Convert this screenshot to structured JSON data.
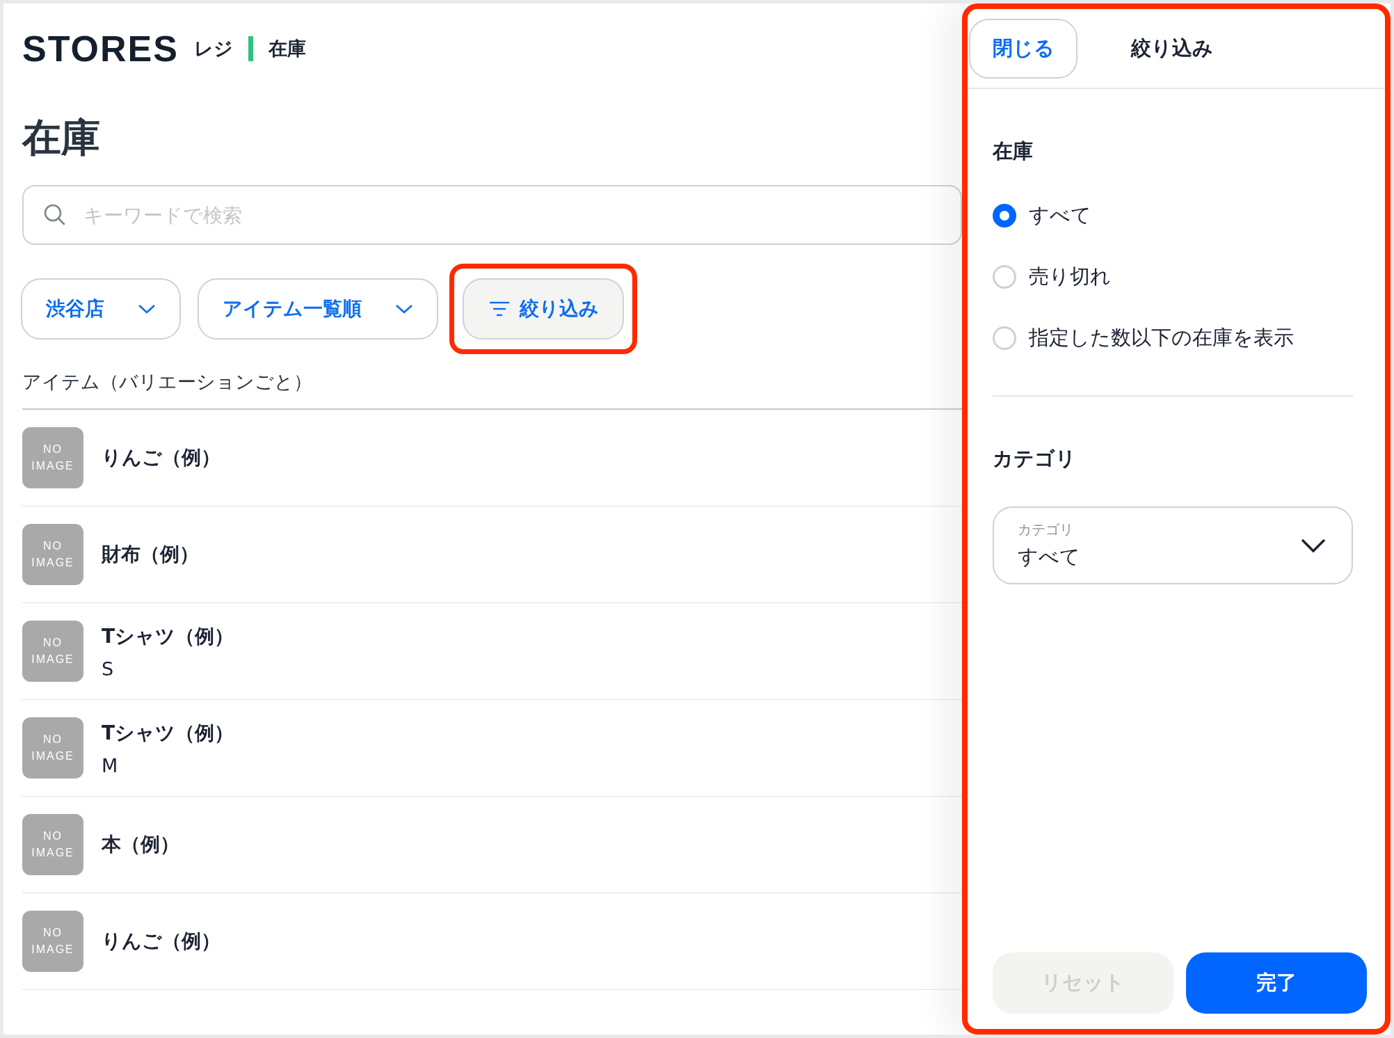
{
  "header": {
    "logo": "STORES",
    "product": "レジ",
    "section": "在庫"
  },
  "page_title": "在庫",
  "search": {
    "placeholder": "キーワードで検索"
  },
  "filters": [
    {
      "label": "渋谷店",
      "kind": "dropdown",
      "highlighted": false
    },
    {
      "label": "アイテム一覧順",
      "kind": "dropdown",
      "highlighted": false
    },
    {
      "label": "絞り込み",
      "kind": "filter",
      "highlighted": true
    }
  ],
  "list_header": "アイテム（バリエーションごと）",
  "items": [
    {
      "image_text": "NO IMAGE",
      "name": "りんご（例）"
    },
    {
      "image_text": "NO IMAGE",
      "name": "財布（例）"
    },
    {
      "image_text": "NO IMAGE",
      "name": "Tシャツ（例）",
      "variant": "S"
    },
    {
      "image_text": "NO IMAGE",
      "name": "Tシャツ（例）",
      "variant": "M"
    },
    {
      "image_text": "NO IMAGE",
      "name": "本（例）"
    },
    {
      "image_text": "NO IMAGE",
      "name": "りんご（例）"
    }
  ],
  "filter_panel": {
    "highlighted": true,
    "close_button": "閉じる",
    "title": "絞り込み",
    "stock_heading": "在庫",
    "stock_options": [
      {
        "label": "すべて",
        "selected": true
      },
      {
        "label": "売り切れ",
        "selected": false
      },
      {
        "label": "指定した数以下の在庫を表示",
        "selected": false
      }
    ],
    "category_heading": "カテゴリ",
    "category_select": {
      "label": "カテゴリ",
      "value": "すべて"
    },
    "buttons": [
      {
        "label": "リセット",
        "kind": "secondary",
        "disabled": true
      },
      {
        "label": "完了",
        "kind": "primary",
        "disabled": false
      }
    ]
  }
}
